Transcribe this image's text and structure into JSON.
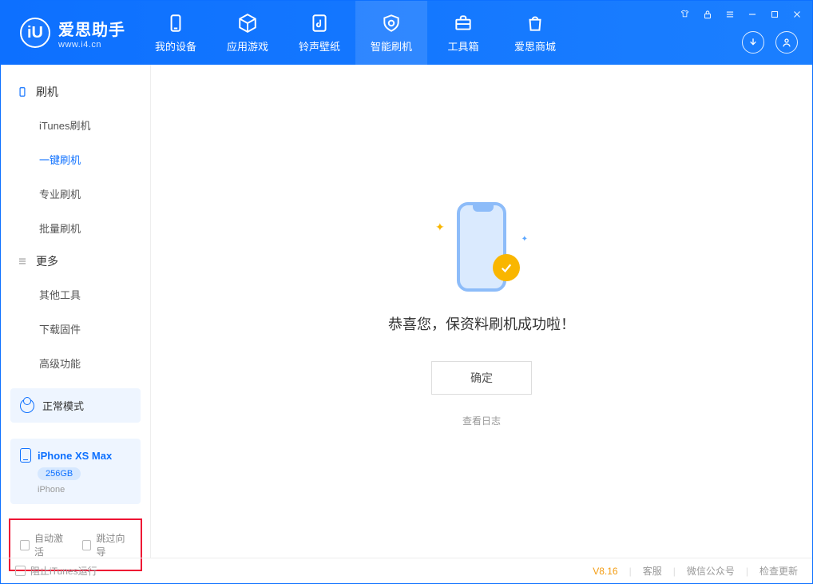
{
  "brand": {
    "name": "爱思助手",
    "url": "www.i4.cn"
  },
  "nav": {
    "items": [
      {
        "label": "我的设备"
      },
      {
        "label": "应用游戏"
      },
      {
        "label": "铃声壁纸"
      },
      {
        "label": "智能刷机"
      },
      {
        "label": "工具箱"
      },
      {
        "label": "爱思商城"
      }
    ]
  },
  "sidebar": {
    "section1_title": "刷机",
    "section1_items": [
      "iTunes刷机",
      "一键刷机",
      "专业刷机",
      "批量刷机"
    ],
    "section2_title": "更多",
    "section2_items": [
      "其他工具",
      "下载固件",
      "高级功能"
    ],
    "mode_label": "正常模式",
    "device_name": "iPhone XS Max",
    "device_capacity": "256GB",
    "device_type": "iPhone",
    "chk_auto_activate": "自动激活",
    "chk_skip_guide": "跳过向导"
  },
  "main": {
    "success_message": "恭喜您，保资料刷机成功啦！",
    "confirm_label": "确定",
    "view_log_label": "查看日志"
  },
  "footer": {
    "block_itunes": "阻止iTunes运行",
    "version": "V8.16",
    "links": [
      "客服",
      "微信公众号",
      "检查更新"
    ]
  }
}
